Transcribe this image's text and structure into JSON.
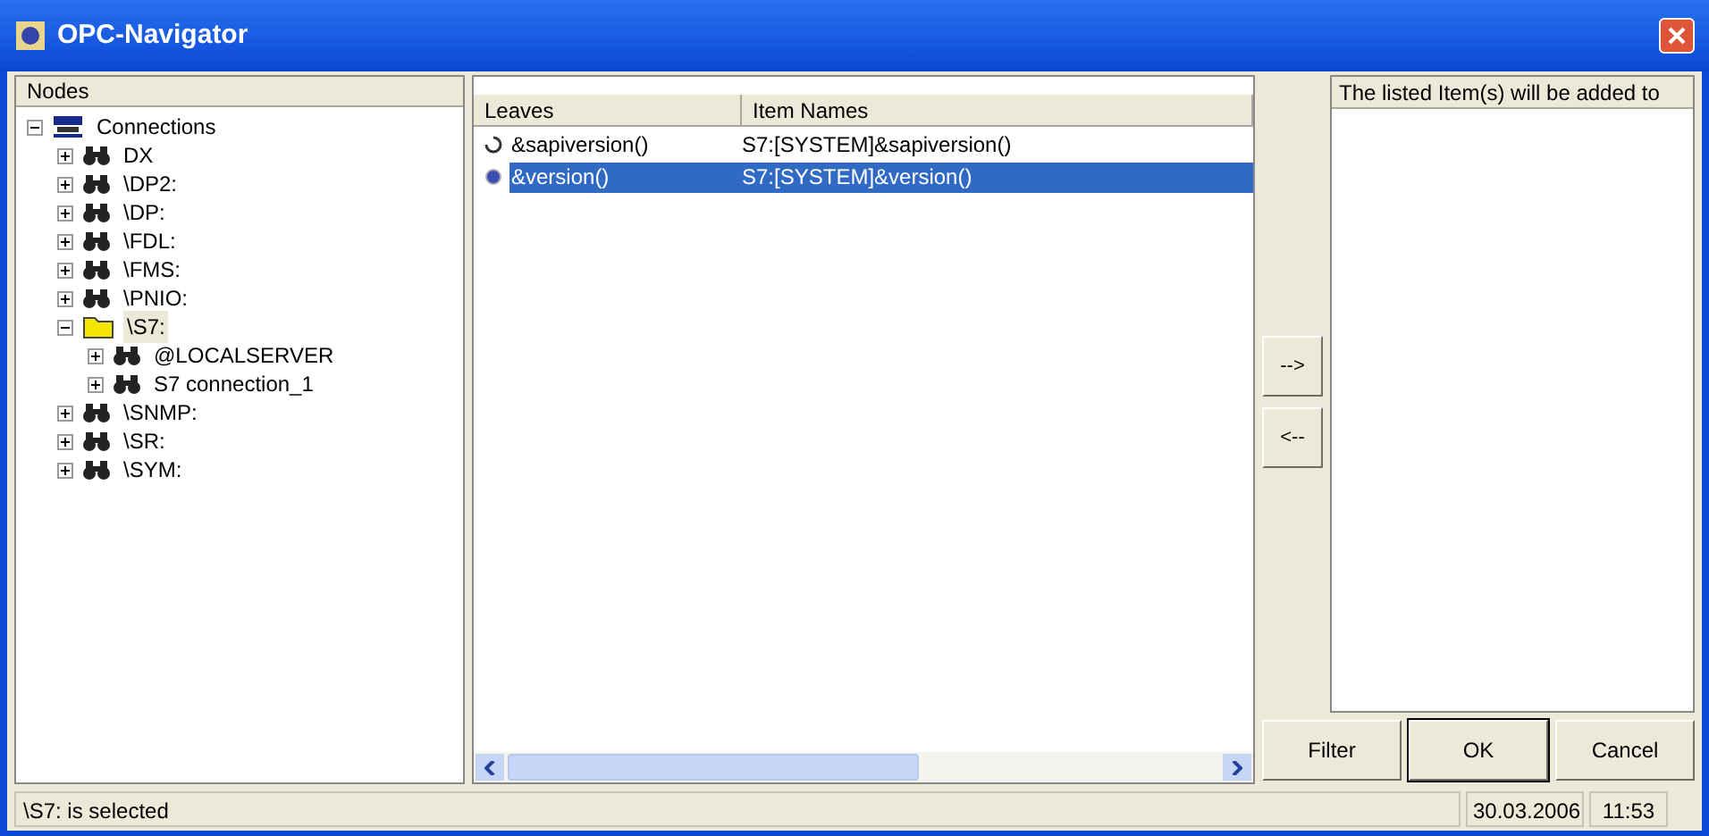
{
  "window": {
    "title": "OPC-Navigator"
  },
  "nodes": {
    "header": "Nodes",
    "tree": [
      {
        "label": "Connections",
        "kind": "opc",
        "expanded": true,
        "selected": false,
        "children": [
          {
            "label": "DX",
            "kind": "binoculars",
            "expanded": false,
            "selected": false
          },
          {
            "label": "\\DP2:",
            "kind": "binoculars",
            "expanded": false,
            "selected": false
          },
          {
            "label": "\\DP:",
            "kind": "binoculars",
            "expanded": false,
            "selected": false
          },
          {
            "label": "\\FDL:",
            "kind": "binoculars",
            "expanded": false,
            "selected": false
          },
          {
            "label": "\\FMS:",
            "kind": "binoculars",
            "expanded": false,
            "selected": false
          },
          {
            "label": "\\PNIO:",
            "kind": "binoculars",
            "expanded": false,
            "selected": false
          },
          {
            "label": "\\S7:",
            "kind": "folder",
            "expanded": true,
            "selected": true,
            "children": [
              {
                "label": "@LOCALSERVER",
                "kind": "binoculars",
                "expanded": false,
                "selected": false
              },
              {
                "label": "S7 connection_1",
                "kind": "binoculars",
                "expanded": false,
                "selected": false
              }
            ]
          },
          {
            "label": "\\SNMP:",
            "kind": "binoculars",
            "expanded": false,
            "selected": false
          },
          {
            "label": "\\SR:",
            "kind": "binoculars",
            "expanded": false,
            "selected": false
          },
          {
            "label": "\\SYM:",
            "kind": "binoculars",
            "expanded": false,
            "selected": false
          }
        ]
      }
    ]
  },
  "leaves": {
    "columns": [
      "Leaves",
      "Item Names"
    ],
    "rows": [
      {
        "leaf": "&sapiversion()",
        "item_name": "S7:[SYSTEM]&sapiversion()",
        "kind": "ring",
        "selected": false
      },
      {
        "leaf": "&version()",
        "item_name": "S7:[SYSTEM]&version()",
        "kind": "dot",
        "selected": true
      }
    ]
  },
  "transfer_buttons": [
    "-->",
    "<--"
  ],
  "added_list": {
    "header": "The listed Item(s) will be added to"
  },
  "buttons": [
    {
      "label": "Filter",
      "default": false
    },
    {
      "label": "OK",
      "default": true
    },
    {
      "label": "Cancel",
      "default": false
    }
  ],
  "status_bar": {
    "message": "\\S7: is selected",
    "date": "30.03.2006",
    "time": "11:53"
  }
}
